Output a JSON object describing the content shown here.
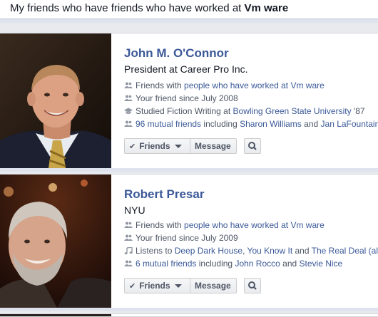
{
  "search": {
    "query_prefix": "My friends who have friends who have worked at ",
    "query_entity": "Vm ware"
  },
  "results": [
    {
      "name": "John M. O'Connor",
      "subtitle": "President at Career Pro Inc.",
      "line1_prefix": "Friends with ",
      "line1_link": "people who have worked at Vm ware",
      "line2": "Your friend since July 2008",
      "line3_prefix": "Studied Fiction Writing at ",
      "line3_link": "Bowling Green State University",
      "line3_suffix": " '87",
      "line4_link": "96 mutual friends",
      "line4_mid": " including ",
      "line4_link2": "Sharon Williams",
      "line4_and": " and ",
      "line4_link3": "Jan LaFountain",
      "friends_label": "Friends",
      "message_label": "Message"
    },
    {
      "name": "Robert Presar",
      "subtitle": "NYU",
      "line1_prefix": "Friends with ",
      "line1_link": "people who have worked at Vm ware",
      "line2": "Your friend since July 2009",
      "line3_prefix": "Listens to ",
      "line3_link": "Deep Dark House",
      "line3_sep1": ", ",
      "line3_link2": "You Know It",
      "line3_and": " and ",
      "line3_link3": "The Real Deal (all",
      "line4_link": "6 mutual friends",
      "line4_mid": " including ",
      "line4_link2": "John Rocco",
      "line4_and": " and ",
      "line4_link3": "Stevie Nice",
      "friends_label": "Friends",
      "message_label": "Message"
    }
  ],
  "colors": {
    "link": "#3b5998",
    "background": "#e9eaed",
    "meta_text": "#4e5665"
  },
  "icons": [
    "friends-icon",
    "education-icon",
    "music-icon",
    "check-icon",
    "search-icon"
  ]
}
